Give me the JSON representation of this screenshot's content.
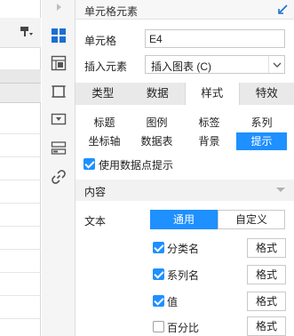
{
  "panel": {
    "title": "单元格元素",
    "cell_label": "单元格",
    "cell_value": "E4",
    "insert_label": "插入元素",
    "insert_value": "插入图表 (C)"
  },
  "tabs": [
    "类型",
    "数据",
    "样式",
    "特效"
  ],
  "active_tab": "样式",
  "subtabs": [
    "标题",
    "图例",
    "标签",
    "系列",
    "坐标轴",
    "数据表",
    "背景",
    "提示"
  ],
  "active_subtab": "提示",
  "use_tooltip": {
    "label": "使用数据点提示",
    "checked": true
  },
  "content_section": {
    "title": "内容"
  },
  "text_row": {
    "label": "文本",
    "options": [
      "通用",
      "自定义"
    ],
    "selected": "通用"
  },
  "options": [
    {
      "label": "分类名",
      "checked": true,
      "format_label": "格式"
    },
    {
      "label": "系列名",
      "checked": true,
      "format_label": "格式"
    },
    {
      "label": "值",
      "checked": true,
      "format_label": "格式"
    },
    {
      "label": "百分比",
      "checked": false,
      "format_label": "格式"
    }
  ],
  "colors": {
    "accent": "#1e90ff",
    "tab_bar": "#e9e9e9",
    "icon_blue": "#1a6fd1"
  },
  "strip_icons": [
    "cell-element-icon",
    "cell-attribute-icon",
    "border-icon",
    "widget-icon",
    "form-icon",
    "hyperlink-icon"
  ]
}
